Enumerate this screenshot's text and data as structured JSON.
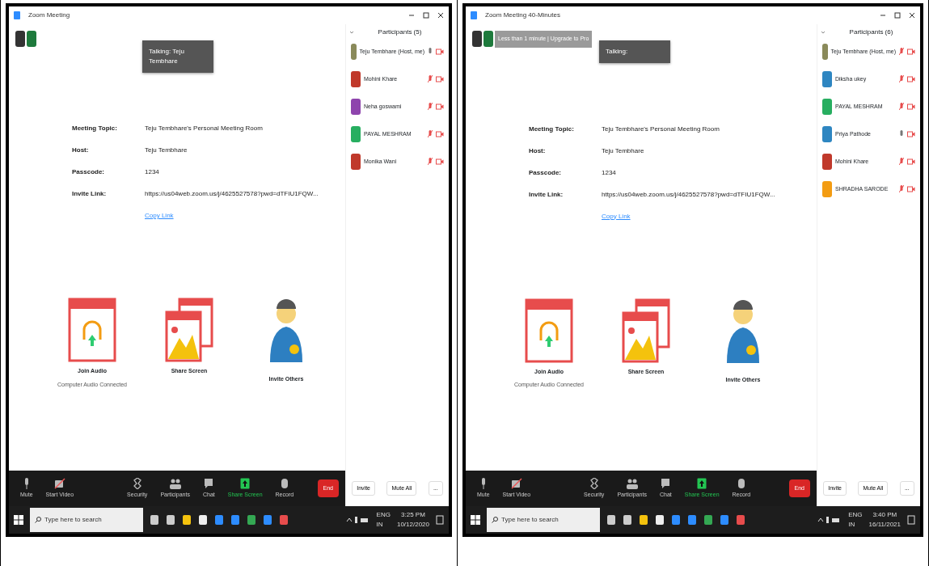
{
  "screenshots": [
    {
      "window": {
        "title": "Zoom Meeting"
      },
      "talking": "Talking: Teju Tembhare",
      "meeting_info": [
        {
          "label": "Meeting Topic:",
          "value": "Teju Tembhare's Personal Meeting Room"
        },
        {
          "label": "Host:",
          "value": "Teju Tembhare"
        },
        {
          "label": "Passcode:",
          "value": "1234"
        },
        {
          "label": "Invite Link:",
          "value": "https://us04web.zoom.us/j/4625527578?pwd=dTFIU1FQW..."
        }
      ],
      "copy_link": "Copy Link",
      "actions": [
        {
          "kind": "audio",
          "label": "Join Audio",
          "caption": "Computer Audio Connected"
        },
        {
          "kind": "share",
          "label": "Share Screen"
        },
        {
          "kind": "invite",
          "label": "Invite Others"
        }
      ],
      "participants_title": "Participants (5)",
      "participants": [
        {
          "name": "Teju Tembhare (Host, me)",
          "kind": "photo",
          "mic_muted": false
        },
        {
          "name": "Mohini Khare",
          "kind": "initials",
          "color": "#c0392b",
          "mic_muted": true
        },
        {
          "name": "Neha goswami",
          "kind": "initials",
          "color": "#8e44ad",
          "mic_muted": true
        },
        {
          "name": "PAYAL MESHRAM",
          "kind": "initials",
          "color": "#27ae60",
          "mic_muted": true
        },
        {
          "name": "Monika Wani",
          "kind": "initials",
          "color": "#c0392b",
          "mic_muted": true
        }
      ],
      "toolbar": [
        {
          "kind": "mic",
          "label": "Mute"
        },
        {
          "kind": "video",
          "label": "Start Video"
        },
        {
          "kind": "security",
          "label": "Security"
        },
        {
          "kind": "participants",
          "label": "Participants"
        },
        {
          "kind": "chat",
          "label": "Chat"
        },
        {
          "kind": "share",
          "label": "Share Screen"
        },
        {
          "kind": "record",
          "label": "Record"
        }
      ],
      "end_button": "End",
      "panel_buttons": [
        "Invite",
        "Mute All",
        "..."
      ],
      "taskbar": {
        "search_placeholder": "Type here to search",
        "lang": "ENG",
        "region": "IN",
        "time": "3:25 PM",
        "date": "10/12/2020"
      }
    },
    {
      "window": {
        "title": "Zoom Meeting 40-Minutes"
      },
      "recording_banner": "Less than 1 minute | Upgrade to Pro",
      "talking": "Talking:",
      "meeting_info": [
        {
          "label": "Meeting Topic:",
          "value": "Teju Tembhare's Personal Meeting Room"
        },
        {
          "label": "Host:",
          "value": "Teju Tembhare"
        },
        {
          "label": "Passcode:",
          "value": "1234"
        },
        {
          "label": "Invite Link:",
          "value": "https://us04web.zoom.us/j/4625527578?pwd=dTFIU1FQW..."
        }
      ],
      "copy_link": "Copy Link",
      "actions": [
        {
          "kind": "audio",
          "label": "Join Audio",
          "caption": "Computer Audio Connected"
        },
        {
          "kind": "share",
          "label": "Share Screen"
        },
        {
          "kind": "invite",
          "label": "Invite Others"
        }
      ],
      "participants_title": "Participants (6)",
      "participants": [
        {
          "name": "Teju Tembhare (Host, me)",
          "kind": "photo",
          "mic_muted": true
        },
        {
          "name": "Diksha ukey",
          "kind": "initials",
          "color": "#2e86c1",
          "mic_muted": true
        },
        {
          "name": "PAYAL MESHRAM",
          "kind": "initials",
          "color": "#27ae60",
          "mic_muted": true
        },
        {
          "name": "Priya Pathode",
          "kind": "initials",
          "color": "#2e86c1",
          "mic_muted": false
        },
        {
          "name": "Mohini Khare",
          "kind": "initials",
          "color": "#c0392b",
          "mic_muted": true
        },
        {
          "name": "SHRADHA SARODE",
          "kind": "initials",
          "color": "#f39c12",
          "mic_muted": true
        }
      ],
      "toolbar": [
        {
          "kind": "mic",
          "label": "Mute"
        },
        {
          "kind": "video",
          "label": "Start Video"
        },
        {
          "kind": "security",
          "label": "Security"
        },
        {
          "kind": "participants",
          "label": "Participants"
        },
        {
          "kind": "chat",
          "label": "Chat"
        },
        {
          "kind": "share",
          "label": "Share Screen"
        },
        {
          "kind": "record",
          "label": "Record"
        }
      ],
      "end_button": "End",
      "panel_buttons": [
        "Invite",
        "Mute All",
        "..."
      ],
      "taskbar": {
        "search_placeholder": "Type here to search",
        "lang": "ENG",
        "region": "IN",
        "time": "3:40 PM",
        "date": "16/11/2021"
      }
    }
  ]
}
